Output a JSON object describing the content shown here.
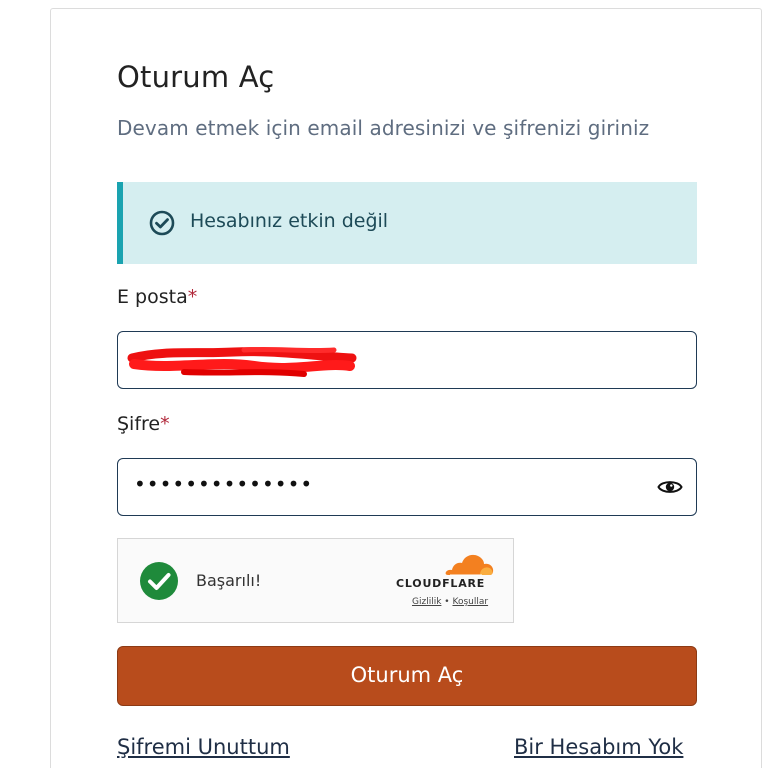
{
  "login": {
    "title": "Oturum Aç",
    "subtitle": "Devam etmek için email adresinizi ve şifrenizi giriniz",
    "alert": {
      "icon": "check-circle-icon",
      "text": "Hesabınız etkin değil"
    },
    "email": {
      "label": "E posta",
      "required_mark": "*",
      "value_redacted": true
    },
    "password": {
      "label": "Şifre",
      "required_mark": "*",
      "value": "••••••••••••••",
      "toggle_icon": "eye-icon"
    },
    "captcha": {
      "status_text": "Başarılı!",
      "status_icon": "success-check-icon",
      "brand": "CLOUDFLARE",
      "privacy_link": "Gizlilik",
      "separator": "•",
      "terms_link": "Koşullar"
    },
    "submit_label": "Oturum Aç",
    "forgot_password": "Şifremi Unuttum",
    "no_account": "Bir Hesabım Yok"
  },
  "colors": {
    "accent_button": "#b84c1c",
    "alert_bg": "#d5eef0",
    "alert_border": "#1aa3b0",
    "required_star": "#b1283a",
    "success_green": "#1f8a3b",
    "cloudflare_orange": "#f38020"
  }
}
